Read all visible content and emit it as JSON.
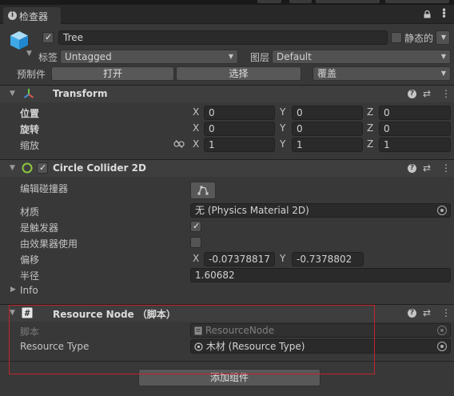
{
  "tab": {
    "title": "检查器",
    "icon": "info-icon"
  },
  "header": {
    "object_name": "Tree",
    "active": true,
    "static_label": "静态的",
    "static": false,
    "tag_label": "标签",
    "tag_value": "Untagged",
    "layer_label": "图层",
    "layer_value": "Default",
    "prefab_label": "预制件",
    "prefab_open": "打开",
    "prefab_select": "选择",
    "prefab_overrides": "覆盖"
  },
  "transform": {
    "title": "Transform",
    "position_label": "位置",
    "rotation_label": "旋转",
    "scale_label": "缩放",
    "position": {
      "x": "0",
      "y": "0",
      "z": "0"
    },
    "rotation": {
      "x": "0",
      "y": "0",
      "z": "0"
    },
    "scale": {
      "x": "1",
      "y": "1",
      "z": "1"
    },
    "axis_x": "X",
    "axis_y": "Y",
    "axis_z": "Z"
  },
  "collider": {
    "title": "Circle Collider 2D",
    "enabled": true,
    "edit_label": "编辑碰撞器",
    "material_label": "材质",
    "material_value": "无 (Physics Material 2D)",
    "trigger_label": "是触发器",
    "trigger": true,
    "effector_label": "由效果器使用",
    "effector": false,
    "offset_label": "偏移",
    "offset": {
      "x": "-0.07378817",
      "y": "-0.7378802"
    },
    "radius_label": "半径",
    "radius": "1.60682",
    "info_label": "Info"
  },
  "resource_node": {
    "title": "Resource Node （脚本）",
    "script_label": "脚本",
    "script_value": "ResourceNode",
    "type_label": "Resource Type",
    "type_value": "木材 (Resource Type)"
  },
  "add_component": "添加组件",
  "colors": {
    "background": "#383838",
    "field": "#2a2a2a",
    "highlight": "#c0262c",
    "transform_y": "#6ec94b",
    "transform_x": "#e0584a",
    "transform_z": "#4a8fe0"
  }
}
